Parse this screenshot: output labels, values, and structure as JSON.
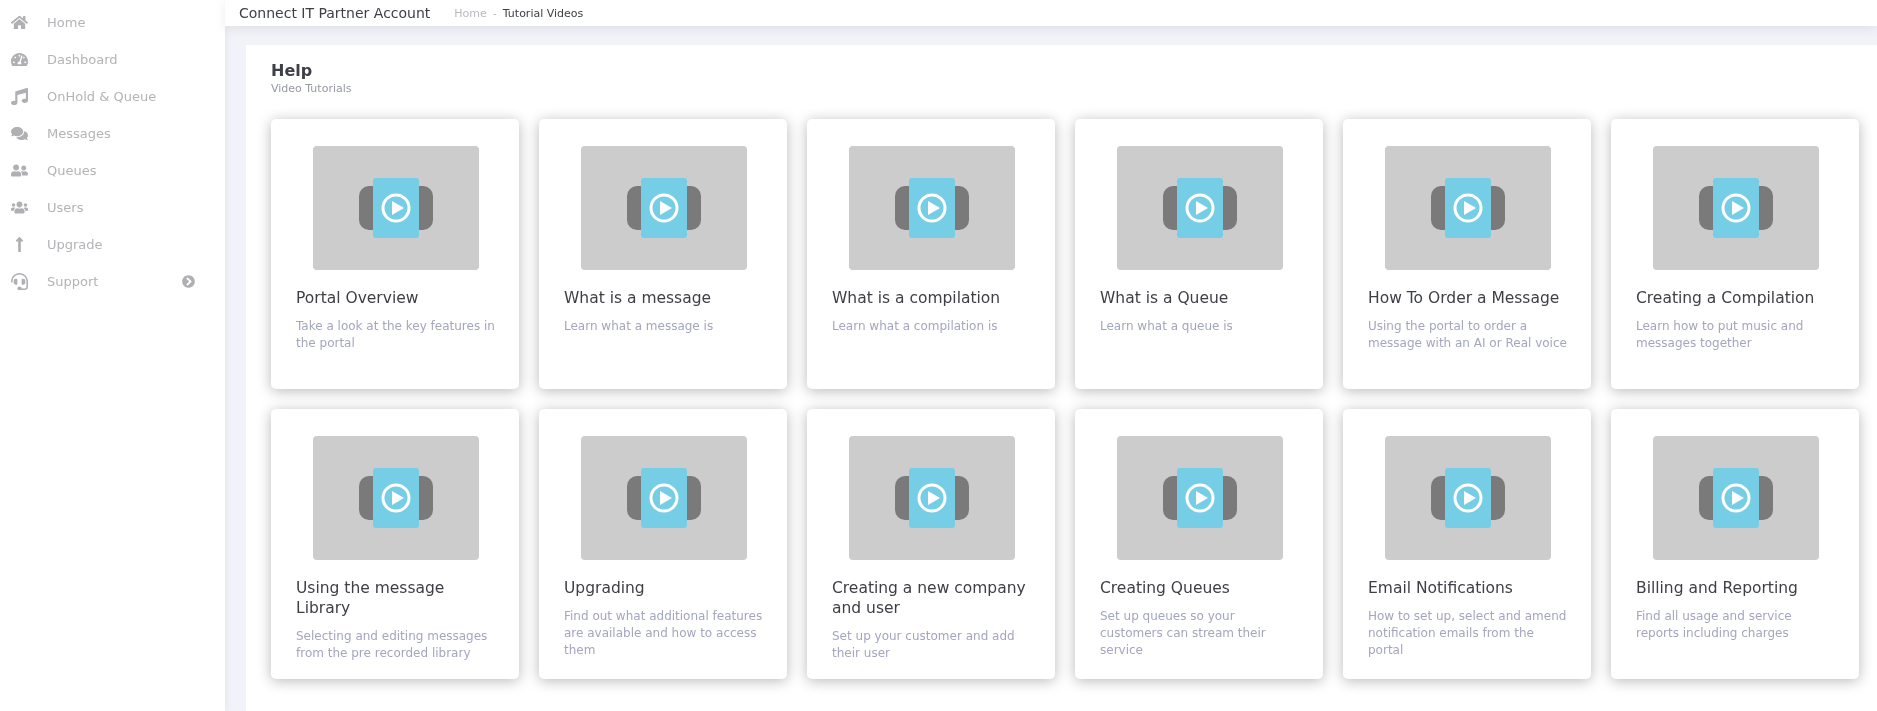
{
  "sidebar": {
    "items": [
      {
        "kind": "home",
        "label": "Home",
        "expandable": false
      },
      {
        "kind": "dashboard",
        "label": "Dashboard",
        "expandable": false
      },
      {
        "kind": "music",
        "label": "OnHold & Queue",
        "expandable": false
      },
      {
        "kind": "messages",
        "label": "Messages",
        "expandable": false
      },
      {
        "kind": "queues",
        "label": "Queues",
        "expandable": false
      },
      {
        "kind": "users",
        "label": "Users",
        "expandable": false
      },
      {
        "kind": "upgrade",
        "label": "Upgrade",
        "expandable": false
      },
      {
        "kind": "support",
        "label": "Support",
        "expandable": true
      }
    ]
  },
  "header": {
    "title": "Connect IT Partner Account",
    "breadcrumb": [
      {
        "label": "Home",
        "current": false
      },
      {
        "label": "Tutorial Videos",
        "current": true
      }
    ],
    "separator": "-"
  },
  "panel": {
    "title": "Help",
    "subtitle": "Video Tutorials",
    "videos": [
      {
        "title": "Portal Overview",
        "description": "Take a look at the key features in the portal"
      },
      {
        "title": "What is a message",
        "description": "Learn what a message is"
      },
      {
        "title": "What is a compilation",
        "description": "Learn what a compilation is"
      },
      {
        "title": "What is a Queue",
        "description": "Learn what a queue is"
      },
      {
        "title": "How To Order a Message",
        "description": "Using the portal to order a message with an AI or Real voice"
      },
      {
        "title": "Creating a Compilation",
        "description": "Learn how to put music and messages together"
      },
      {
        "title": "Using the message Library",
        "description": "Selecting and editing messages from the pre recorded library"
      },
      {
        "title": "Upgrading",
        "description": "Find out what additional features are available and how to access them"
      },
      {
        "title": "Creating a new company and user",
        "description": "Set up your customer and add their user"
      },
      {
        "title": "Creating Queues",
        "description": "Set up queues so your customers can stream their service"
      },
      {
        "title": "Email Notifications",
        "description": "How to set up, select and amend notification emails from the portal"
      },
      {
        "title": "Billing and Reporting",
        "description": "Find all usage and service reports including charges"
      }
    ]
  }
}
